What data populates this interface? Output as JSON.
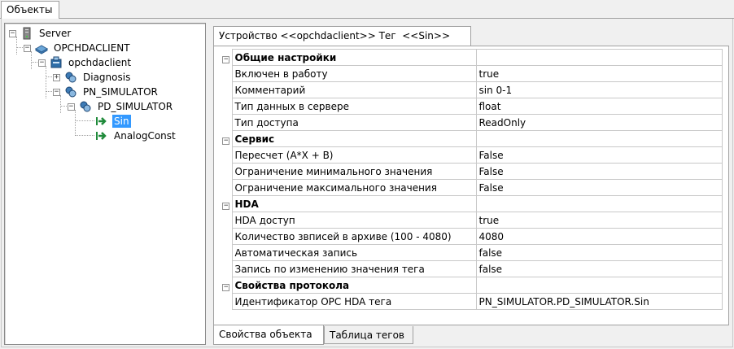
{
  "top_tab": {
    "label": "Объекты"
  },
  "tree": [
    {
      "label": "Server",
      "icon": "server-icon",
      "expander": "−"
    },
    {
      "label": "OPCHDACLIENT",
      "icon": "module-icon",
      "expander": "−"
    },
    {
      "label": "opchdaclient",
      "icon": "device-icon",
      "expander": "−"
    },
    {
      "label": "Diagnosis",
      "icon": "folder-icon",
      "expander": "+"
    },
    {
      "label": "PN_SIMULATOR",
      "icon": "folder-icon",
      "expander": "−"
    },
    {
      "label": "PD_SIMULATOR",
      "icon": "folder-icon",
      "expander": "−"
    },
    {
      "label": "Sin",
      "icon": "tag-icon",
      "expander": ""
    },
    {
      "label": "AnalogConst",
      "icon": "tag-icon",
      "expander": ""
    }
  ],
  "doc_tab": {
    "label": "Устройство <<opchdaclient>> Тег  <<Sin>>"
  },
  "property_grid": {
    "categories": [
      {
        "name": "Общие настройки",
        "rows": [
          {
            "name": "Включен в работу",
            "value": "true"
          },
          {
            "name": "Комментарий",
            "value": "sin 0-1"
          },
          {
            "name": "Тип данных в сервере",
            "value": "float"
          },
          {
            "name": "Тип доступа",
            "value": "ReadOnly"
          }
        ]
      },
      {
        "name": "Сервис",
        "rows": [
          {
            "name": "Пересчет (A*X + B)",
            "value": "False"
          },
          {
            "name": "Ограничение минимального значения",
            "value": "False"
          },
          {
            "name": "Ограничение максимального значения",
            "value": "False"
          }
        ]
      },
      {
        "name": "HDA",
        "rows": [
          {
            "name": "HDA доступ",
            "value": "true"
          },
          {
            "name": "Количество звписей в архиве (100 - 4080)",
            "value": "4080"
          },
          {
            "name": "Автоматическая запись",
            "value": "false"
          },
          {
            "name": "Запись по изменению значения тега",
            "value": "false"
          }
        ]
      },
      {
        "name": "Свойства протокола",
        "rows": [
          {
            "name": "Идентификатор OPC HDA тега",
            "value": "PN_SIMULATOR.PD_SIMULATOR.Sin"
          }
        ]
      }
    ]
  },
  "bottom_tabs": [
    {
      "label": "Свойства объекта"
    },
    {
      "label": "Таблица тегов"
    }
  ],
  "colors": {
    "selection": "#3399ff",
    "tag_arrow": "#1f8a3a",
    "folder_icon": "#3d7bb6"
  }
}
